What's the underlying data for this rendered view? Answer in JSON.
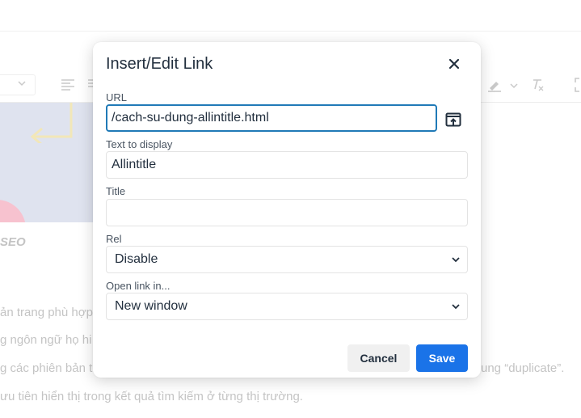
{
  "background": {
    "caption": "SEO",
    "lines": [
      "ản trang phù hợp",
      "g ngôn ngữ họ hi",
      "g các phiên bản t",
      "ung “duplicate”.",
      "ưu tiên hiển thị trong kết quả tìm kiếm ở từng thị trường."
    ]
  },
  "dialog": {
    "title": "Insert/Edit Link",
    "close_icon": "close-icon",
    "url": {
      "label": "URL",
      "value": "/cach-su-dung-allintitle.html",
      "browse_icon": "browse-link-icon"
    },
    "text_to_display": {
      "label": "Text to display",
      "value": "Allintitle"
    },
    "title_field": {
      "label": "Title",
      "value": ""
    },
    "rel": {
      "label": "Rel",
      "selected": "Disable"
    },
    "target": {
      "label": "Open link in...",
      "selected": "New window"
    },
    "buttons": {
      "cancel": "Cancel",
      "save": "Save"
    }
  },
  "colors": {
    "accent": "#1a73e8",
    "focus_border": "#207ab7",
    "text": "#222f3e",
    "cancel_bg": "#f0f0f0"
  }
}
